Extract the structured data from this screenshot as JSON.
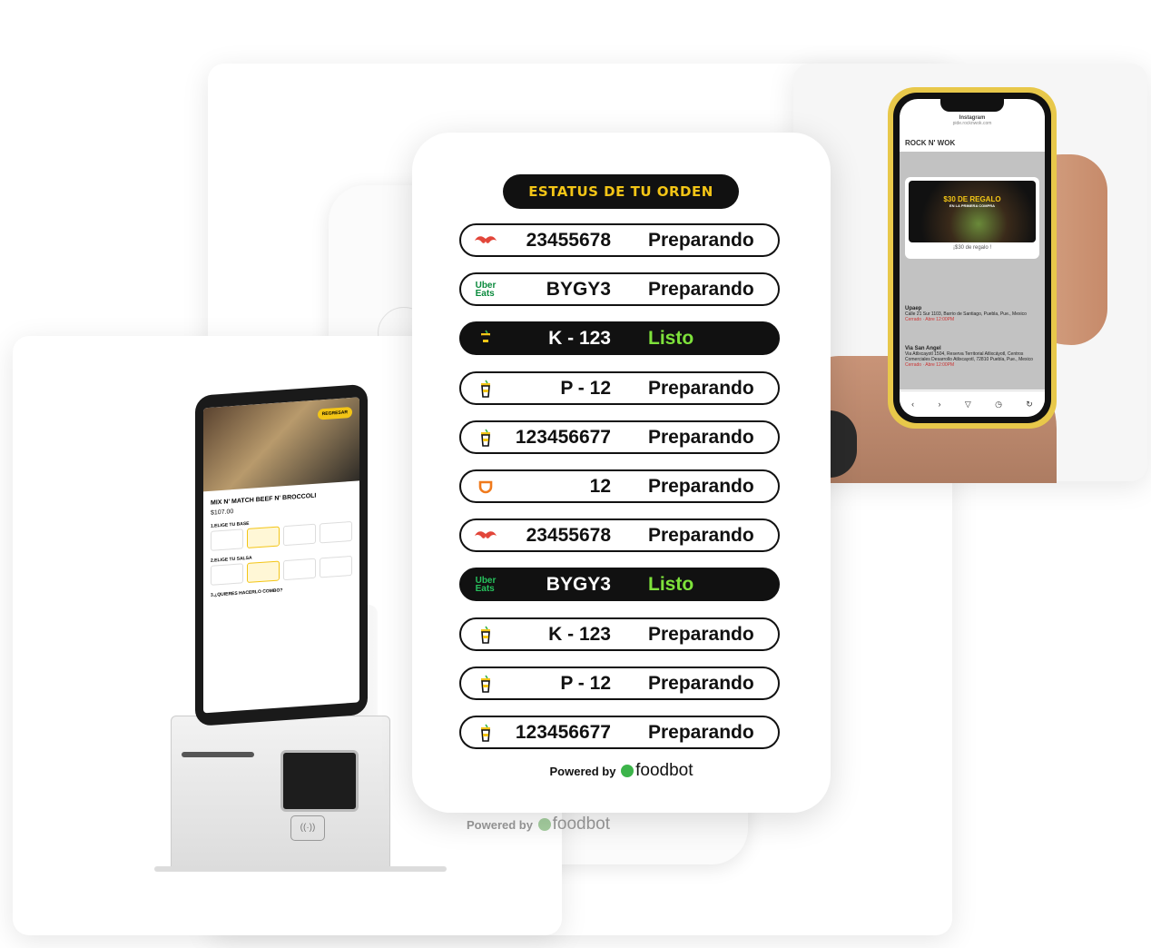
{
  "status_panel": {
    "title": "ESTATUS DE TU ORDEN",
    "rows": [
      {
        "icon": "rappi-mustache-icon",
        "code": "23455678",
        "status": "Preparando",
        "state": "pending"
      },
      {
        "icon": "uber-eats-logo",
        "code": "BYGY3",
        "status": "Preparando",
        "state": "pending"
      },
      {
        "icon": "drink-cup-icon",
        "code": "K - 123",
        "status": "Listo",
        "state": "ready"
      },
      {
        "icon": "drink-cup-icon",
        "code": "P - 12",
        "status": "Preparando",
        "state": "pending"
      },
      {
        "icon": "drink-cup-icon",
        "code": "123456677",
        "status": "Preparando",
        "state": "pending"
      },
      {
        "icon": "didi-food-icon",
        "code": "12",
        "status": "Preparando",
        "state": "pending"
      },
      {
        "icon": "rappi-mustache-icon",
        "code": "23455678",
        "status": "Preparando",
        "state": "pending"
      },
      {
        "icon": "uber-eats-logo",
        "code": "BYGY3",
        "status": "Listo",
        "state": "ready"
      },
      {
        "icon": "drink-cup-icon",
        "code": "K - 123",
        "status": "Preparando",
        "state": "pending"
      },
      {
        "icon": "drink-cup-icon",
        "code": "P - 12",
        "status": "Preparando",
        "state": "pending"
      },
      {
        "icon": "drink-cup-icon",
        "code": "123456677",
        "status": "Preparando",
        "state": "pending"
      }
    ],
    "uber_line1": "Uber",
    "uber_line2": "Eats",
    "powered_by": "Powered by",
    "brand": "foodbot"
  },
  "ghost_powered": {
    "powered_by": "Powered by",
    "brand": "foodbot"
  },
  "kiosk": {
    "badge": "REGRESAR",
    "item_title": "MIX N' MATCH BEEF N' BROCCOLI",
    "price": "$107.00",
    "section1": "1.ELIGE TU BASE",
    "section2": "2.ELIGE TU SALSA",
    "section3": "3.¿QUIERES HACERLO COMBO?"
  },
  "phone": {
    "app": "Instagram",
    "url": "pide.rocknwok.com",
    "brand": "ROCK N' WOK",
    "promo_title": "$30 DE REGALO",
    "promo_sub": "EN LA PRIMERA COMPRA",
    "promo_caption": "¡$30 de regalo !",
    "locations": [
      {
        "name": "Upaep",
        "addr": "Calle 21 Sur 1103, Barrio de Santiago, Puebla, Pue., Mexico",
        "hours": "Cerrado · Abre 12:00PM"
      },
      {
        "name": "Via San Angel",
        "addr": "Via Atlixcayotl 1504, Reserva Territorial Atlixcáyotl, Centros Comerciales Desarrollo Atlixcayotl, 72810 Puebla, Pue., Mexico",
        "hours": "Cerrado · Abre 12:00PM"
      }
    ]
  },
  "colors": {
    "accent": "#f3c516",
    "ready": "#7ee23b",
    "foodbot_green": "#3cb44a"
  }
}
